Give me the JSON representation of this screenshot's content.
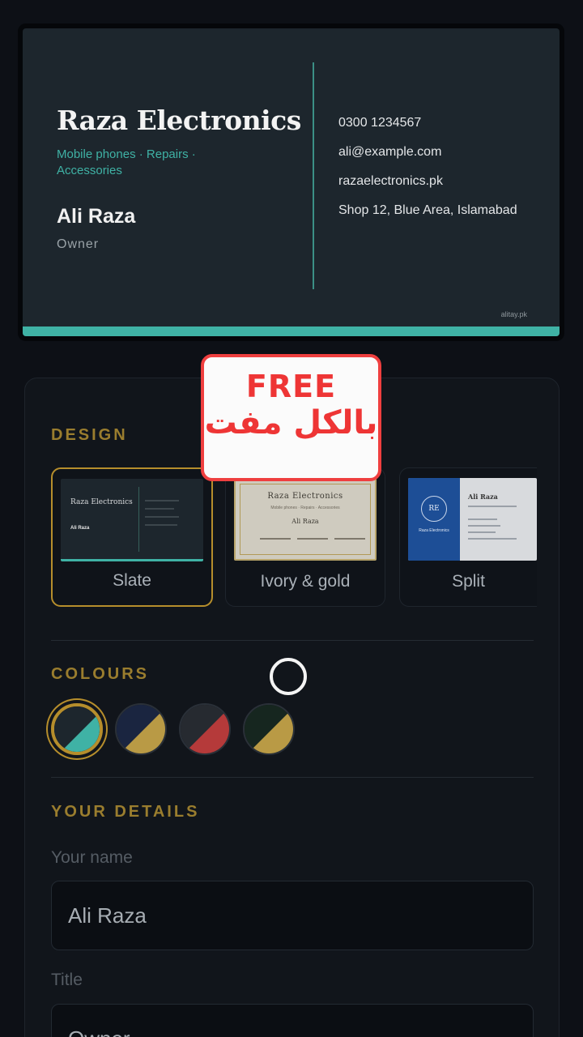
{
  "card": {
    "business_name": "Raza Electronics",
    "tagline": "Mobile phones · Repairs · Accessories",
    "person_name": "Ali Raza",
    "person_title": "Owner",
    "phone": "0300 1234567",
    "email": "ali@example.com",
    "website": "razaelectronics.pk",
    "address": "Shop 12, Blue Area, Islamabad",
    "watermark": "alitay.pk",
    "accent_color": "#3fb2a5"
  },
  "sticker": {
    "title": "FREE",
    "subtitle": "بالکل مفت"
  },
  "design": {
    "heading": "DESIGN",
    "options": [
      {
        "label": "Slate",
        "selected": true,
        "thumb_title": "Raza Electronics",
        "thumb_name": "Ali Raza"
      },
      {
        "label": "Ivory & gold",
        "selected": false,
        "thumb_title": "Raza Electronics",
        "thumb_sub": "Mobile phones · Repairs · Accessories",
        "thumb_name": "Ali Raza"
      },
      {
        "label": "Split",
        "selected": false,
        "thumb_initials": "RE",
        "thumb_biz": "Raza Electronics",
        "thumb_name": "Ali Raza"
      }
    ]
  },
  "colours": {
    "heading": "COLOURS",
    "swatches": [
      {
        "name": "slate-teal",
        "dark": "#1d262d",
        "accent": "#3fb2a5",
        "selected": true
      },
      {
        "name": "navy-gold",
        "dark": "#1a2540",
        "accent": "#b99a45",
        "selected": false
      },
      {
        "name": "charcoal-red",
        "dark": "#262a30",
        "accent": "#b53a3a",
        "selected": false
      },
      {
        "name": "forest-gold",
        "dark": "#16261f",
        "accent": "#b99a45",
        "selected": false
      }
    ]
  },
  "details": {
    "heading": "YOUR DETAILS",
    "name_label": "Your name",
    "name_value": "Ali Raza",
    "title_label": "Title",
    "title_value": "Owner"
  }
}
